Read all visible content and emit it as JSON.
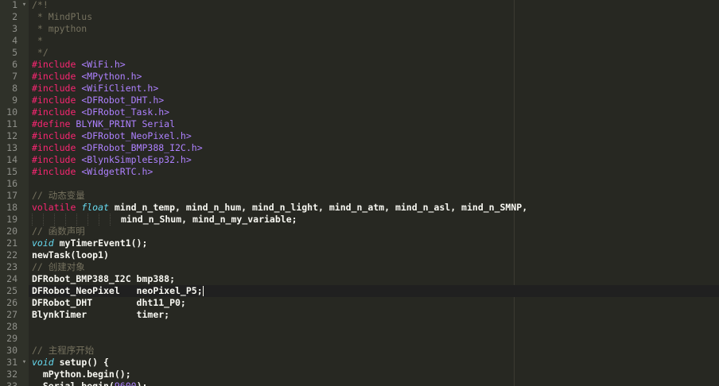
{
  "editor": {
    "lines": [
      [
        {
          "t": "/*!",
          "c": "comment"
        }
      ],
      [
        {
          "t": " * MindPlus",
          "c": "comment"
        }
      ],
      [
        {
          "t": " * mpython",
          "c": "comment"
        }
      ],
      [
        {
          "t": " *",
          "c": "comment"
        }
      ],
      [
        {
          "t": " */",
          "c": "comment"
        }
      ],
      [
        {
          "t": "#include ",
          "c": "pp"
        },
        {
          "t": "<WiFi.h>",
          "c": "header"
        }
      ],
      [
        {
          "t": "#include ",
          "c": "pp"
        },
        {
          "t": "<MPython.h>",
          "c": "header"
        }
      ],
      [
        {
          "t": "#include ",
          "c": "pp"
        },
        {
          "t": "<WiFiClient.h>",
          "c": "header"
        }
      ],
      [
        {
          "t": "#include ",
          "c": "pp"
        },
        {
          "t": "<DFRobot_DHT.h>",
          "c": "header"
        }
      ],
      [
        {
          "t": "#include ",
          "c": "pp"
        },
        {
          "t": "<DFRobot_Task.h>",
          "c": "header"
        }
      ],
      [
        {
          "t": "#define ",
          "c": "pp"
        },
        {
          "t": "BLYNK_PRINT Serial",
          "c": "header"
        }
      ],
      [
        {
          "t": "#include ",
          "c": "pp"
        },
        {
          "t": "<DFRobot_NeoPixel.h>",
          "c": "header"
        }
      ],
      [
        {
          "t": "#include ",
          "c": "pp"
        },
        {
          "t": "<DFRobot_BMP388_I2C.h>",
          "c": "header"
        }
      ],
      [
        {
          "t": "#include ",
          "c": "pp"
        },
        {
          "t": "<BlynkSimpleEsp32.h>",
          "c": "header"
        }
      ],
      [
        {
          "t": "#include ",
          "c": "pp"
        },
        {
          "t": "<WidgetRTC.h>",
          "c": "header"
        }
      ],
      [],
      [
        {
          "t": "// 动态变量",
          "c": "comment"
        }
      ],
      [
        {
          "t": "volatile ",
          "c": "pp"
        },
        {
          "t": "float",
          "c": "storage"
        },
        {
          "t": " mind_n_temp, mind_n_hum, mind_n_light, mind_n_atm, mind_n_asl, mind_n_SMNP,",
          "c": "ident"
        }
      ],
      [
        {
          "indent": 8
        },
        {
          "t": "mind_n_Shum, mind_n_my_variable;",
          "c": "ident"
        }
      ],
      [
        {
          "t": "// 函数声明",
          "c": "comment"
        }
      ],
      [
        {
          "t": "void",
          "c": "storage"
        },
        {
          "t": " myTimerEvent1();",
          "c": "ident"
        }
      ],
      [
        {
          "t": "newTask(loop1)",
          "c": "ident"
        }
      ],
      [
        {
          "t": "// 创建对象",
          "c": "comment"
        }
      ],
      [
        {
          "t": "DFRobot_BMP388_I2C bmp388;",
          "c": "ident"
        }
      ],
      [
        {
          "t": "DFRobot_NeoPixel   neoPixel_P5;",
          "c": "ident"
        },
        {
          "caret": true
        }
      ],
      [
        {
          "t": "DFRobot_DHT        dht11_P0;",
          "c": "ident"
        }
      ],
      [
        {
          "t": "BlynkTimer         timer;",
          "c": "ident"
        }
      ],
      [],
      [],
      [
        {
          "t": "// 主程序开始",
          "c": "comment"
        }
      ],
      [
        {
          "t": "void",
          "c": "storage"
        },
        {
          "t": " setup() {",
          "c": "ident"
        }
      ],
      [
        {
          "t": "  mPython.begin();",
          "c": "ident"
        }
      ],
      [
        {
          "t": "  Serial.begin(",
          "c": "ident"
        },
        {
          "t": "9600",
          "c": "number"
        },
        {
          "t": ");",
          "c": "ident"
        }
      ]
    ],
    "line_numbers": [
      "1",
      "2",
      "3",
      "4",
      "5",
      "6",
      "7",
      "8",
      "9",
      "10",
      "11",
      "12",
      "13",
      "14",
      "15",
      "16",
      "17",
      "18",
      "19",
      "20",
      "21",
      "22",
      "23",
      "24",
      "25",
      "26",
      "27",
      "28",
      "29",
      "30",
      "31",
      "32",
      "33"
    ],
    "fold_markers": {
      "1": "fold-open-icon",
      "31": "fold-open-icon"
    },
    "active_line": 25,
    "colors": {
      "background": "#272822",
      "gutter": "#2f3129",
      "comment": "#75715e",
      "preprocessor": "#f92672",
      "header": "#ae81ff",
      "storage": "#66d9ef",
      "text": "#f8f8f2",
      "active_line": "#202020"
    }
  }
}
